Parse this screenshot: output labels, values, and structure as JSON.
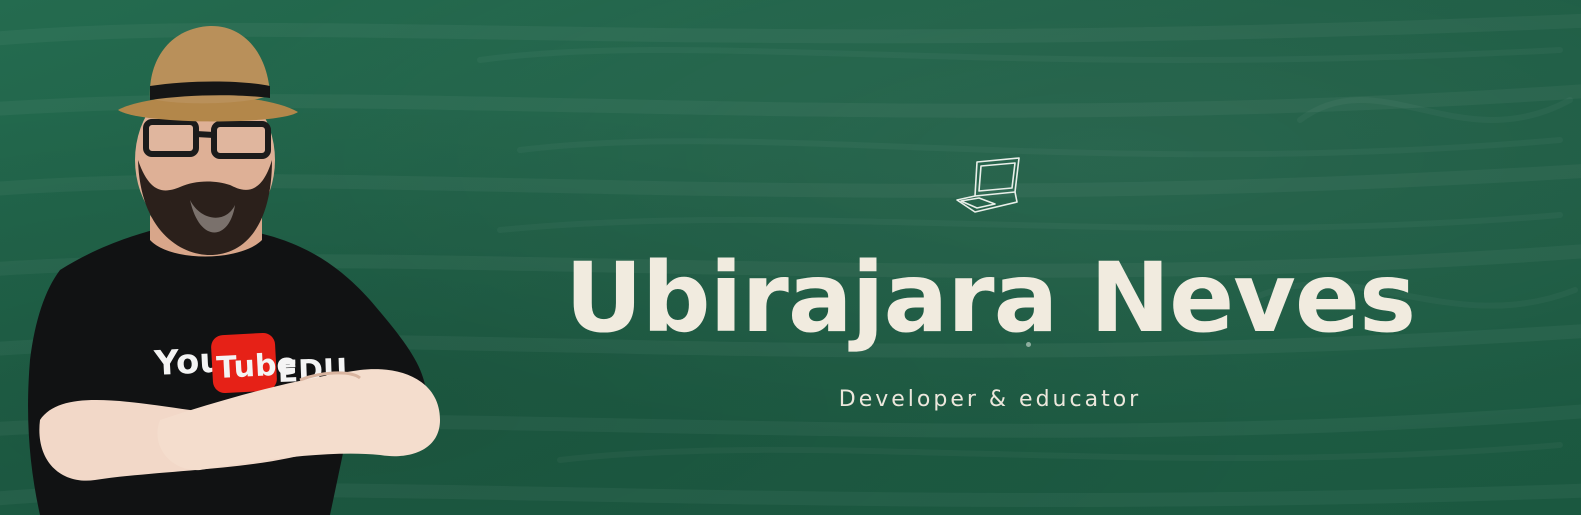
{
  "banner": {
    "name": "Ubirajara Neves",
    "subtitle": "Developer & educator",
    "shirt_print": "YouTube EDU",
    "icon": "laptop-icon"
  },
  "colors": {
    "background": "#1f5e46",
    "text": "#f1ebdf",
    "shirt": "#111111",
    "youtube_red": "#e62117"
  }
}
